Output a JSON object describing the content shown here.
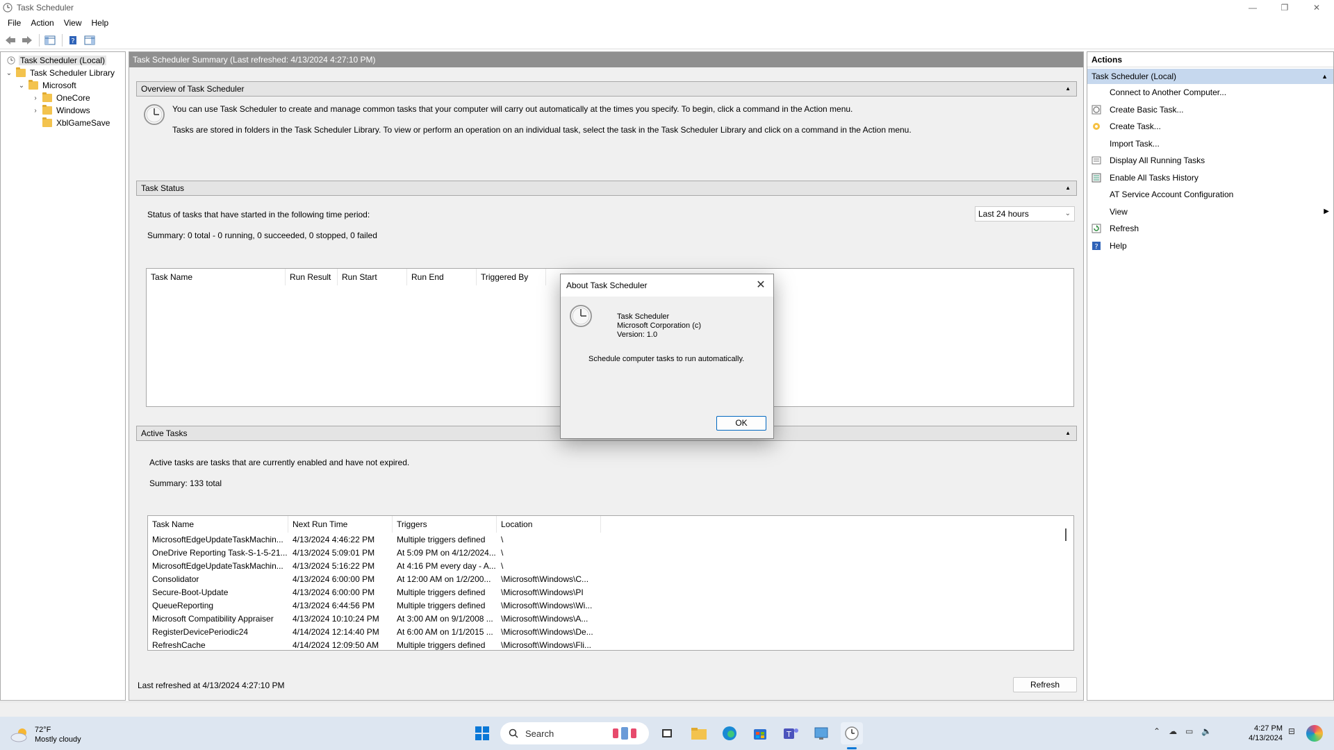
{
  "window": {
    "title": "Task Scheduler",
    "controls": {
      "minimize": "—",
      "restore": "❐",
      "close": "✕"
    }
  },
  "menu": [
    "File",
    "Action",
    "View",
    "Help"
  ],
  "tree": {
    "root": "Task Scheduler (Local)",
    "library": "Task Scheduler Library",
    "microsoft": "Microsoft",
    "onecore": "OneCore",
    "windows": "Windows",
    "xbl": "XblGameSave"
  },
  "center": {
    "header": "Task Scheduler Summary (Last refreshed: 4/13/2024 4:27:10 PM)",
    "overview": {
      "title": "Overview of Task Scheduler",
      "text1": "You can use Task Scheduler to create and manage common tasks that your computer will carry out automatically at the times you specify. To begin, click a command in the Action menu.",
      "text2": "Tasks are stored in folders in the Task Scheduler Library. To view or perform an operation on an individual task, select the task in the Task Scheduler Library and click on a command in the Action menu."
    },
    "status": {
      "title": "Task Status",
      "period_label": "Status of tasks that have started in the following time period:",
      "period_value": "Last 24 hours",
      "summary": "Summary: 0 total - 0 running, 0 succeeded, 0 stopped, 0 failed",
      "columns": [
        "Task Name",
        "Run Result",
        "Run Start",
        "Run End",
        "Triggered By"
      ]
    },
    "active": {
      "title": "Active Tasks",
      "desc": "Active tasks are tasks that are currently enabled and have not expired.",
      "summary": "Summary: 133 total",
      "columns": [
        "Task Name",
        "Next Run Time",
        "Triggers",
        "Location"
      ],
      "rows": [
        [
          "MicrosoftEdgeUpdateTaskMachin...",
          "4/13/2024 4:46:22 PM",
          "Multiple triggers defined",
          "\\"
        ],
        [
          "OneDrive Reporting Task-S-1-5-21...",
          "4/13/2024 5:09:01 PM",
          "At 5:09 PM on 4/12/2024...",
          "\\"
        ],
        [
          "MicrosoftEdgeUpdateTaskMachin...",
          "4/13/2024 5:16:22 PM",
          "At 4:16 PM every day - A...",
          "\\"
        ],
        [
          "Consolidator",
          "4/13/2024 6:00:00 PM",
          "At 12:00 AM on 1/2/200...",
          "\\Microsoft\\Windows\\C..."
        ],
        [
          "Secure-Boot-Update",
          "4/13/2024 6:00:00 PM",
          "Multiple triggers defined",
          "\\Microsoft\\Windows\\PI"
        ],
        [
          "QueueReporting",
          "4/13/2024 6:44:56 PM",
          "Multiple triggers defined",
          "\\Microsoft\\Windows\\Wi..."
        ],
        [
          "Microsoft Compatibility Appraiser",
          "4/13/2024 10:10:24 PM",
          "At 3:00 AM on 9/1/2008 ...",
          "\\Microsoft\\Windows\\A..."
        ],
        [
          "RegisterDevicePeriodic24",
          "4/14/2024 12:14:40 PM",
          "At 6:00 AM on 1/1/2015 ...",
          "\\Microsoft\\Windows\\De..."
        ],
        [
          "RefreshCache",
          "4/14/2024 12:09:50 AM",
          "Multiple triggers defined",
          "\\Microsoft\\Windows\\Fli..."
        ]
      ]
    },
    "footer": {
      "last_refreshed": "Last refreshed at 4/13/2024 4:27:10 PM",
      "refresh_button": "Refresh"
    }
  },
  "actions": {
    "title": "Actions",
    "group": "Task Scheduler (Local)",
    "items": [
      "Connect to Another Computer...",
      "Create Basic Task...",
      "Create Task...",
      "Import Task...",
      "Display All Running Tasks",
      "Enable All Tasks History",
      "AT Service Account Configuration",
      "View",
      "Refresh",
      "Help"
    ]
  },
  "dialog": {
    "title": "About Task Scheduler",
    "product": "Task Scheduler",
    "company": "Microsoft Corporation (c)",
    "version": "Version: 1.0",
    "description": "Schedule computer tasks to run automatically.",
    "ok": "OK"
  },
  "taskbar": {
    "temperature": "72°F",
    "weather": "Mostly cloudy",
    "search_placeholder": "Search",
    "time": "4:27 PM",
    "date": "4/13/2024"
  },
  "colors": {
    "accent": "#c6d8ee",
    "summary_header": "#8f8f8f",
    "taskbar": "#dde6f1"
  }
}
